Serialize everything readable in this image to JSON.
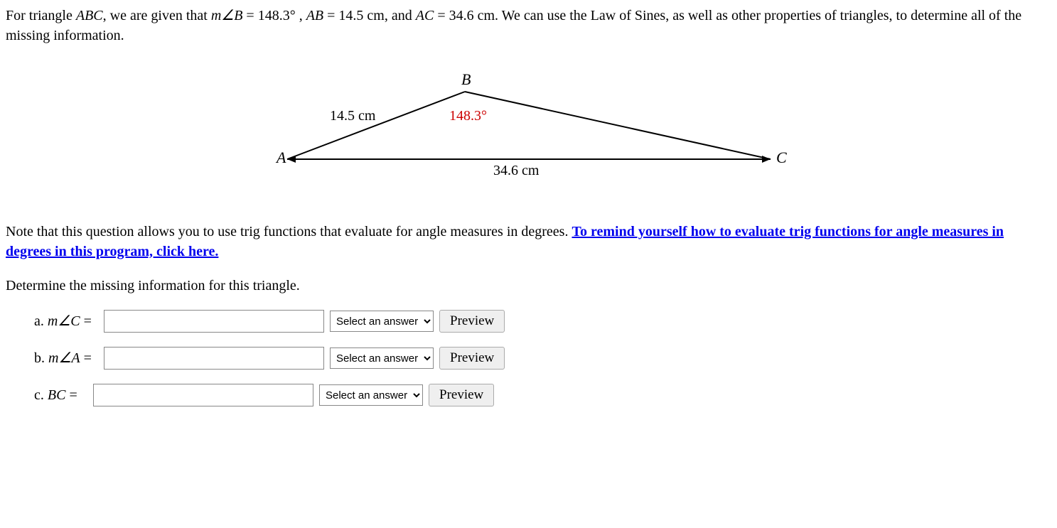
{
  "problem": {
    "prefix": "For triangle ",
    "triangle": "ABC",
    "text1": ", we are given that ",
    "angleB_label": "m∠B",
    "equals": " = ",
    "angleB_value": "148.3°",
    "sep1": " , ",
    "AB_label": "AB",
    "AB_value": "14.5 cm",
    "sep2": ", and ",
    "AC_label": "AC",
    "AC_value": "34.6 cm",
    "text2": ". We can use the Law of Sines, as well as other properties of triangles, to determine all of the missing information."
  },
  "diagram": {
    "vertex_A": "A",
    "vertex_B": "B",
    "vertex_C": "C",
    "side_AB": "14.5 cm",
    "side_AC": "34.6 cm",
    "angle_B": "148.3°"
  },
  "note": {
    "plain": "Note that this question allows you to use trig functions that evaluate for angle measures in degrees. ",
    "link": "To remind yourself how to evaluate trig functions for angle measures in degrees in this program, click here."
  },
  "instruction": "Determine the missing information for this triangle.",
  "answers": {
    "a": {
      "prefix": "a. ",
      "label": "m∠C",
      "equals": " = "
    },
    "b": {
      "prefix": "b. ",
      "label": "m∠A",
      "equals": " = "
    },
    "c": {
      "prefix": "c. ",
      "label": "BC",
      "equals": " = "
    }
  },
  "select_placeholder": "Select an answer",
  "preview_label": "Preview"
}
